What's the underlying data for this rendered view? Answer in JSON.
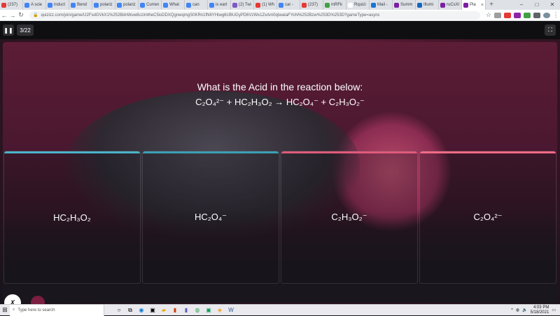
{
  "browser": {
    "tabs": [
      {
        "label": "(237)",
        "color": "#e53935"
      },
      {
        "label": "A scie",
        "color": "#4285f4"
      },
      {
        "label": "induct",
        "color": "#4285f4"
      },
      {
        "label": "Bend",
        "color": "#4285f4"
      },
      {
        "label": "polariz",
        "color": "#4285f4"
      },
      {
        "label": "polariz",
        "color": "#4285f4"
      },
      {
        "label": "Curren",
        "color": "#4285f4"
      },
      {
        "label": "What",
        "color": "#4285f4"
      },
      {
        "label": "can",
        "color": "#4285f4"
      },
      {
        "label": "is eart",
        "color": "#4285f4"
      },
      {
        "label": "(2) Twi",
        "color": "#7e57c2"
      },
      {
        "label": "(1) Wh",
        "color": "#e53935"
      },
      {
        "label": "car -",
        "color": "#4285f4"
      },
      {
        "label": "(237)",
        "color": "#e53935"
      },
      {
        "label": "mRFk",
        "color": "#43a047"
      },
      {
        "label": "Rquizi",
        "color": "#ffffff"
      },
      {
        "label": "Mail -",
        "color": "#1976d2"
      },
      {
        "label": "Summ",
        "color": "#7b1fa2"
      },
      {
        "label": "Illumi",
        "color": "#1565c0"
      },
      {
        "label": "ruCsXl",
        "color": "#7b1fa2"
      },
      {
        "label": "Pla",
        "color": "#7b1fa2"
      }
    ],
    "new_tab": "+",
    "url": "quizizz.com/join/game/U2FsdGVkX1%252BdnWuw8czimtheC5isDDXQgnwqmgS0KRn1fN6YHiwg6UBUGyPD6VzWx1ZxAm0qtwaIaFYoN%252Bzw%253D%253D?gameType=async"
  },
  "quiz": {
    "counter": "3/22",
    "question": "What is the Acid in the reaction below:",
    "equation": "C₂O₄²⁻ + HC₂H₃O₂ → HC₂O₄⁻ + C₂H₃O₂⁻",
    "options": [
      "HC₂H₃O₂",
      "HC₂O₄⁻",
      "C₂H₃O₂⁻",
      "C₂O₄²⁻"
    ]
  },
  "taskbar": {
    "search_placeholder": "Type here to search",
    "time": "4:03 PM",
    "date": "5/18/2021"
  }
}
